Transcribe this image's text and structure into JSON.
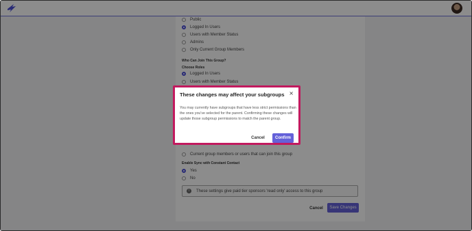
{
  "visibility_options": [
    {
      "label": "Public",
      "selected": false
    },
    {
      "label": "Logged In Users",
      "selected": true
    },
    {
      "label": "Users with Member Status",
      "selected": false
    },
    {
      "label": "Admins",
      "selected": false
    },
    {
      "label": "Only Current Group Members",
      "selected": false
    }
  ],
  "join": {
    "heading": "Who Can Join This Group?",
    "subheading": "Choose Roles",
    "options": [
      {
        "label": "Logged In Users",
        "selected": true
      },
      {
        "label": "Users with Member Status",
        "selected": false
      }
    ]
  },
  "lower_options": [
    {
      "label": "Current group members or users that can join this group",
      "selected": false
    }
  ],
  "sync": {
    "heading": "Enable Sync with Constant Contact",
    "options": [
      {
        "label": "Yes",
        "selected": true
      },
      {
        "label": "No",
        "selected": false
      }
    ]
  },
  "info_banner": "These settings give paid tier sponsors 'read only' access to this group",
  "footer": {
    "cancel": "Cancel",
    "save": "Save Changes"
  },
  "modal": {
    "title": "These changes may affect your subgroups",
    "close": "×",
    "body": "You may currently have subgroups that have less strict permissions than the ones you've selected for the parent. Confirming these changes will update those subgroup permissions to match the parent group.",
    "cancel": "Cancel",
    "confirm": "Confirm",
    "border_color": "#c2195e",
    "accent_color": "#6461d9"
  },
  "icons": {
    "logo": "brand-logo-icon",
    "avatar": "user-avatar",
    "info": "info-icon",
    "close": "close-icon"
  }
}
